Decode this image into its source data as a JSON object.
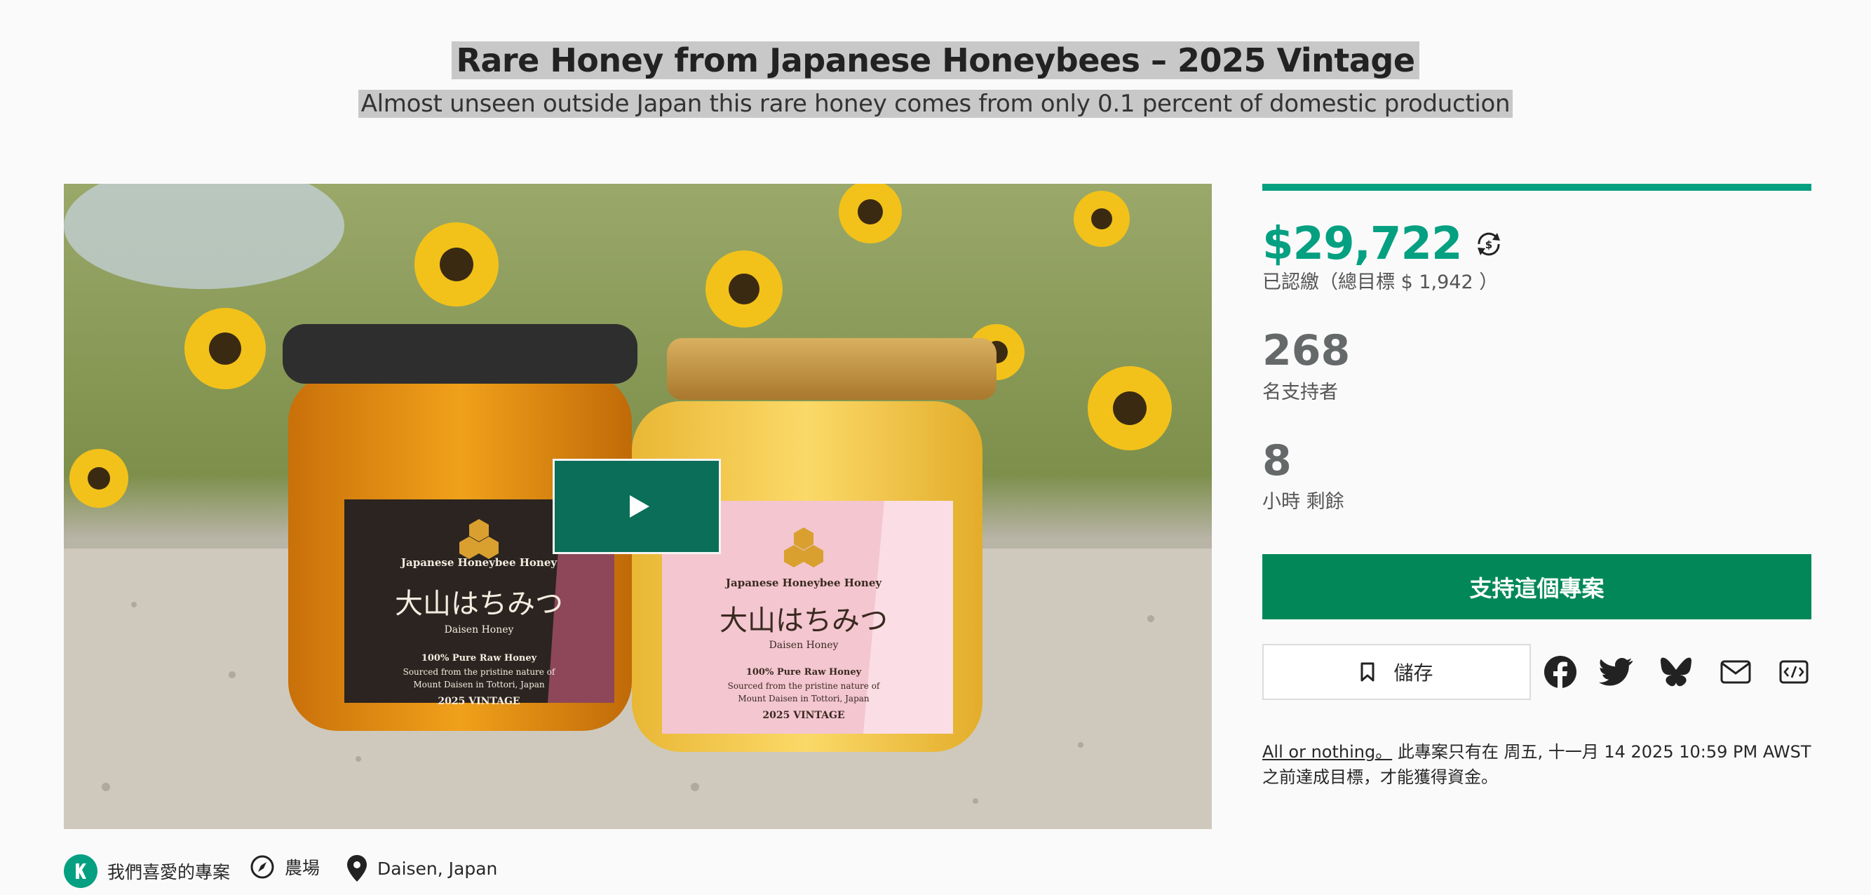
{
  "project": {
    "title": "Rare Honey from Japanese Honeybees – 2025 Vintage",
    "subtitle": "Almost unseen outside Japan this rare honey comes from only 0.1 percent of domestic production"
  },
  "video": {
    "play_icon": "play-icon",
    "jars": [
      {
        "label_line1": "Japanese Honeybee Honey",
        "label_name": "大山はちみつ",
        "label_name_en": "Daisen Honey",
        "label_desc1": "100% Pure Raw Honey",
        "label_desc2": "Sourced from the pristine nature of",
        "label_desc3": "Mount Daisen in Tottori, Japan",
        "label_vintage": "2025 VINTAGE"
      },
      {
        "label_line1": "Japanese Honeybee Honey",
        "label_name": "大山はちみつ",
        "label_name_en": "Daisen Honey",
        "label_desc1": "100% Pure Raw Honey",
        "label_desc2": "Sourced from the pristine nature of",
        "label_desc3": "Mount Daisen in Tottori, Japan",
        "label_vintage": "2025 VINTAGE"
      }
    ]
  },
  "stats": {
    "progress_fraction": 1.0,
    "pledged": "$29,722",
    "pledged_label": "已認繳（總目標 $ 1,942 ）",
    "backers": "268",
    "backers_label": "名支持者",
    "remaining": "8",
    "remaining_label": "小時 剩餘"
  },
  "actions": {
    "back_label": "支持這個專案",
    "save_label": "儲存",
    "share_icons": [
      "facebook-icon",
      "twitter-icon",
      "bluesky-icon",
      "email-icon",
      "embed-icon"
    ]
  },
  "funding_note": {
    "link": "All or nothing。",
    "text": " 此專案只有在 周五, 十一月 14 2025 10:59 PM AWST 之前達成目標，才能獲得資金。"
  },
  "tags": {
    "loved": "我們喜愛的專案",
    "category": "農場",
    "location": "Daisen, Japan"
  },
  "colors": {
    "accent": "#05a081",
    "button": "#028858",
    "play_button": "#0a6e58"
  }
}
